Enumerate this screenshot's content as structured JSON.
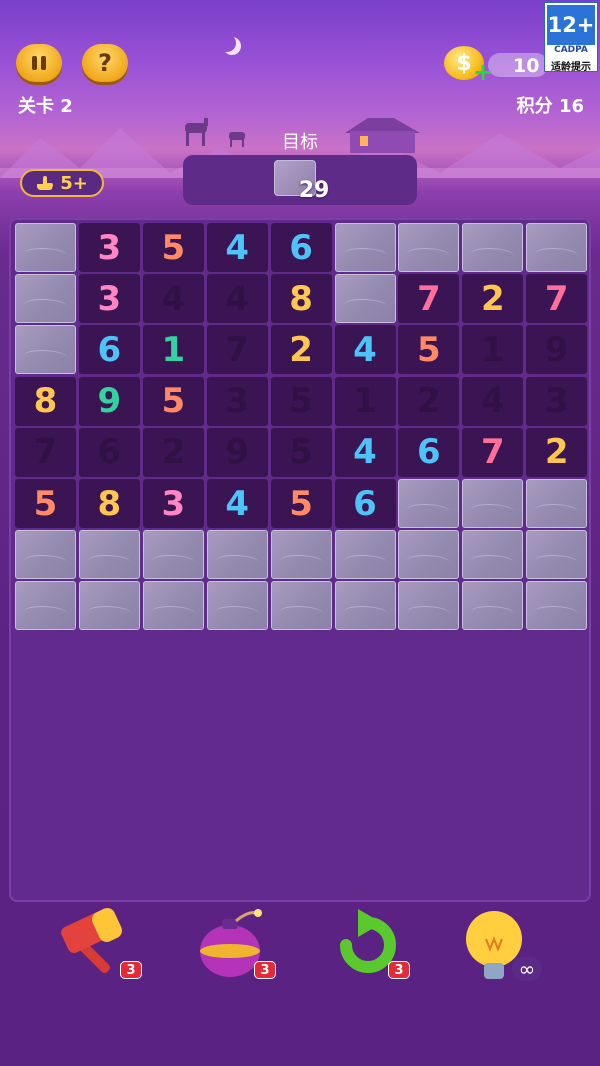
{
  "header": {
    "level_label": "关卡 2",
    "score_label": "积分 16",
    "coins": "10",
    "coin_symbol": "$",
    "coin_plus": "+",
    "pause_label": "pause",
    "help_label": "?",
    "age_rating": {
      "rating": "12+",
      "org": "CADPA",
      "notice": "适龄提示"
    }
  },
  "goal": {
    "label": "目标",
    "count": "29",
    "tile": "stone-block"
  },
  "moves": {
    "label": "5+",
    "icon": "pointing-hand-icon"
  },
  "board": {
    "cols": 9,
    "rows": 8,
    "cells": [
      [
        "S",
        "3",
        "5",
        "4",
        "6",
        "S",
        "S",
        "S",
        "S"
      ],
      [
        "S",
        "3",
        "4",
        "4",
        "8",
        "S",
        "7",
        "2",
        "7"
      ],
      [
        "S",
        "6",
        "1",
        "7",
        "2",
        "4",
        "5",
        "1",
        "9"
      ],
      [
        "8",
        "9",
        "5",
        "3",
        "5",
        "1",
        "2",
        "4",
        "3"
      ],
      [
        "7",
        "6",
        "2",
        "9",
        "5",
        "4",
        "6",
        "7",
        "2"
      ],
      [
        "5",
        "8",
        "3",
        "4",
        "5",
        "6",
        "S",
        "S",
        "S"
      ],
      [
        "S",
        "S",
        "S",
        "S",
        "S",
        "S",
        "S",
        "S",
        "S"
      ],
      [
        "S",
        "S",
        "S",
        "S",
        "S",
        "S",
        "S",
        "S",
        "S"
      ]
    ],
    "faded": [
      [
        0,
        0,
        0,
        0,
        0,
        0,
        0,
        0,
        0
      ],
      [
        0,
        0,
        1,
        1,
        0,
        0,
        0,
        0,
        0
      ],
      [
        0,
        0,
        0,
        1,
        0,
        0,
        0,
        1,
        1
      ],
      [
        0,
        0,
        0,
        1,
        1,
        1,
        1,
        1,
        1
      ],
      [
        1,
        1,
        1,
        1,
        1,
        0,
        0,
        0,
        0
      ],
      [
        0,
        0,
        0,
        0,
        0,
        0,
        0,
        0,
        0
      ],
      [
        0,
        0,
        0,
        0,
        0,
        0,
        0,
        0,
        0
      ],
      [
        0,
        0,
        0,
        0,
        0,
        0,
        0,
        0,
        0
      ]
    ],
    "digit_colors": {
      "1": "#33d2a0",
      "2": "#ffc74f",
      "3": "#ff86c2",
      "4": "#4fc3f7",
      "5": "#ff8a65",
      "6": "#4fc3f7",
      "7": "#ff6f9a",
      "8": "#ffc74f",
      "9": "#33d2a0"
    }
  },
  "tools": [
    {
      "name": "hammer",
      "icon": "hammer-icon",
      "count": "3"
    },
    {
      "name": "bomb",
      "icon": "bomb-icon",
      "count": "3"
    },
    {
      "name": "undo",
      "icon": "undo-arrow-icon",
      "count": "3"
    },
    {
      "name": "hint",
      "icon": "lightbulb-icon",
      "count": "∞"
    }
  ]
}
